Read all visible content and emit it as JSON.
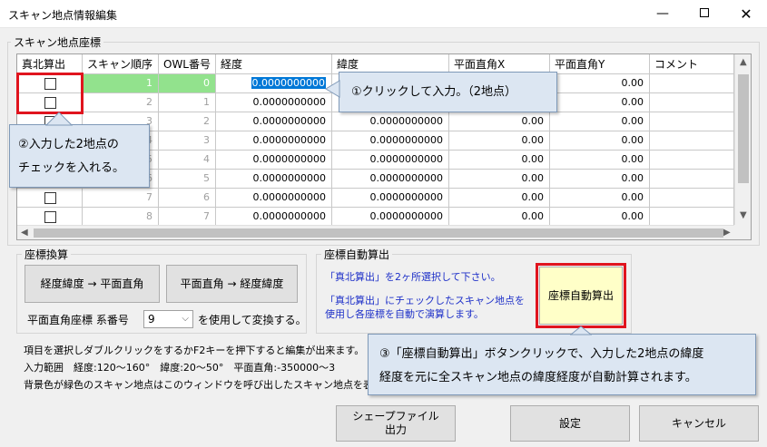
{
  "window": {
    "title": "スキャン地点情報編集",
    "minimize": "—",
    "close": "✕"
  },
  "scan_group": {
    "label": "スキャン地点座標"
  },
  "grid": {
    "columns": [
      "真北算出",
      "スキャン順序",
      "OWL番号",
      "経度",
      "緯度",
      "平面直角X",
      "平面直角Y",
      "コメント"
    ],
    "rows": [
      {
        "order": "1",
        "owl": "0",
        "lon": "0.0000000000",
        "lat": "",
        "x": "",
        "y": "0.00",
        "green": true,
        "selected": true
      },
      {
        "order": "2",
        "owl": "1",
        "lon": "0.0000000000",
        "lat": "",
        "x": "",
        "y": "0.00"
      },
      {
        "order": "3",
        "owl": "2",
        "lon": "0.0000000000",
        "lat": "0.0000000000",
        "x": "0.00",
        "y": "0.00"
      },
      {
        "order": "4",
        "owl": "3",
        "lon": "0.0000000000",
        "lat": "0.0000000000",
        "x": "0.00",
        "y": "0.00"
      },
      {
        "order": "5",
        "owl": "4",
        "lon": "0.0000000000",
        "lat": "0.0000000000",
        "x": "0.00",
        "y": "0.00"
      },
      {
        "order": "6",
        "owl": "5",
        "lon": "0.0000000000",
        "lat": "0.0000000000",
        "x": "0.00",
        "y": "0.00"
      },
      {
        "order": "7",
        "owl": "6",
        "lon": "0.0000000000",
        "lat": "0.0000000000",
        "x": "0.00",
        "y": "0.00"
      },
      {
        "order": "8",
        "owl": "7",
        "lon": "0.0000000000",
        "lat": "0.0000000000",
        "x": "0.00",
        "y": "0.00"
      }
    ]
  },
  "convert": {
    "label": "座標換算",
    "btn_to_plane": "経度緯度 → 平面直角",
    "btn_to_lonlat": "平面直角 → 経度緯度",
    "system_label": "平面直角座標 系番号",
    "system_value": "9",
    "system_suffix": "を使用して変換する。"
  },
  "auto": {
    "label": "座標自動算出",
    "line1": "「真北算出」を2ヶ所選択して下さい。",
    "line2": "「真北算出」にチェックしたスキャン地点を",
    "line3": "使用し各座標を自動で演算します。",
    "button": "座標自動算出"
  },
  "notes": {
    "line1": "項目を選択しダブルクリックをするかF2キーを押下すると編集が出来ます。",
    "line2": "入力範囲　経度:120～160°　緯度:20～50°　平面直角:-350000～3",
    "line3": "背景色が緑色のスキャン地点はこのウィンドウを呼び出したスキャン地点を表"
  },
  "buttons": {
    "shape_line1": "シェープファイル",
    "shape_line2": "出力",
    "settings": "設定",
    "cancel": "キャンセル"
  },
  "callouts": {
    "c1": "①クリックして入力。（2地点）",
    "c2_line1": "②入力した2地点の",
    "c2_line2": "チェックを入れる。",
    "c3_line1": "③「座標自動算出」ボタンクリックで、入力した2地点の緯度",
    "c3_line2": "経度を元に全スキャン地点の緯度経度が自動計算されます。"
  },
  "colors": {
    "highlight_red": "#e0141e",
    "callout_bg": "#dce6f2",
    "green_row": "#92e28d",
    "auto_button_bg": "#ffffc8",
    "info_blue": "#1e30c8"
  }
}
